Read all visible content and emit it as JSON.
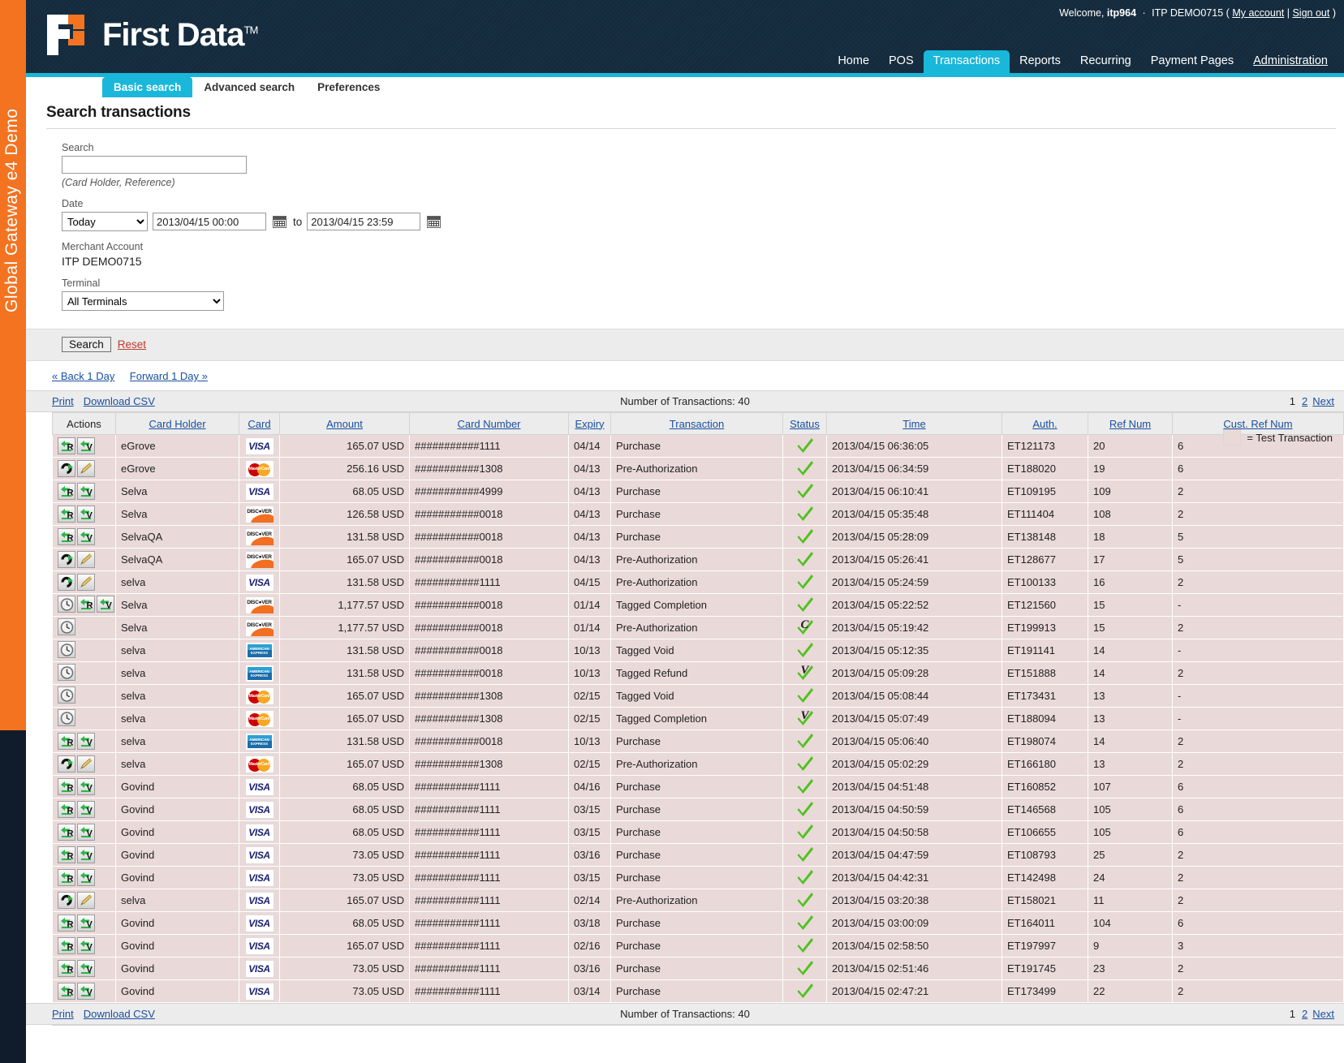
{
  "rail": {
    "label": "Global Gateway e4 Demo"
  },
  "header": {
    "brand_name": "First Data",
    "brand_tm": "TM",
    "welcome_prefix": "Welcome,",
    "user": "itp964",
    "separator": "·",
    "merchant": "ITP DEMO0715",
    "paren_open": "(",
    "my_account": "My account",
    "pipe": "|",
    "sign_out": "Sign out",
    "paren_close": ")",
    "nav": [
      {
        "label": "Home",
        "state": "normal"
      },
      {
        "label": "POS",
        "state": "normal"
      },
      {
        "label": "Transactions",
        "state": "active"
      },
      {
        "label": "Reports",
        "state": "normal"
      },
      {
        "label": "Recurring",
        "state": "normal"
      },
      {
        "label": "Payment Pages",
        "state": "normal"
      },
      {
        "label": "Administration",
        "state": "underline"
      }
    ]
  },
  "subtabs": [
    {
      "label": "Basic search",
      "active": true
    },
    {
      "label": "Advanced search",
      "active": false
    },
    {
      "label": "Preferences",
      "active": false
    }
  ],
  "page": {
    "title": "Search transactions"
  },
  "form": {
    "search_label": "Search",
    "search_value": "",
    "search_placeholder": "",
    "search_hint": "(Card Holder, Reference)",
    "date_label": "Date",
    "date_preset": "Today",
    "date_preset_options": [
      "Today"
    ],
    "date_from": "2013/04/15 00:00",
    "date_to": "2013/04/15 23:59",
    "date_to_word": "to",
    "merchant_label": "Merchant Account",
    "merchant_value": "ITP DEMO0715",
    "terminal_label": "Terminal",
    "terminal_value": "All Terminals",
    "terminal_options": [
      "All Terminals"
    ],
    "search_button": "Search",
    "reset_link": "Reset"
  },
  "daynav": {
    "back": "« Back 1 Day",
    "forward": "Forward 1 Day »"
  },
  "legend": {
    "text": "= Test Transaction",
    "swatch_color": "#ead9d9"
  },
  "toolbar": {
    "print": "Print",
    "download_csv": "Download CSV",
    "count_text": "Number of Transactions: 40",
    "page_current": "1",
    "page_two": "2",
    "next": "Next"
  },
  "table": {
    "columns": [
      {
        "label": "Actions",
        "sortable": false,
        "key": "actions"
      },
      {
        "label": "Card Holder",
        "sortable": true,
        "key": "holder"
      },
      {
        "label": "Card",
        "sortable": true,
        "key": "card"
      },
      {
        "label": "Amount",
        "sortable": true,
        "key": "amount"
      },
      {
        "label": "Card Number",
        "sortable": true,
        "key": "number"
      },
      {
        "label": "Expiry",
        "sortable": true,
        "key": "expiry"
      },
      {
        "label": "Transaction",
        "sortable": true,
        "key": "transaction"
      },
      {
        "label": "Status",
        "sortable": true,
        "key": "status"
      },
      {
        "label": "Time",
        "sortable": true,
        "key": "time"
      },
      {
        "label": "Auth.",
        "sortable": true,
        "key": "auth"
      },
      {
        "label": "Ref Num",
        "sortable": true,
        "key": "refnum"
      },
      {
        "label": "Cust. Ref Num",
        "sortable": true,
        "key": "custref"
      }
    ],
    "rows": [
      {
        "actions": [
          "refund",
          "void"
        ],
        "holder": "eGrove",
        "card": "visa",
        "amount": "165.07  USD",
        "number": "###########1111",
        "expiry": "04/14",
        "transaction": "Purchase",
        "status": "check",
        "time": "2013/04/15 06:36:05",
        "auth": "ET121173",
        "refnum": "20",
        "custref": "6"
      },
      {
        "actions": [
          "complete",
          "edit"
        ],
        "holder": "eGrove",
        "card": "mc",
        "amount": "256.16  USD",
        "number": "###########1308",
        "expiry": "04/13",
        "transaction": "Pre-Authorization",
        "status": "check",
        "time": "2013/04/15 06:34:59",
        "auth": "ET188020",
        "refnum": "19",
        "custref": "6"
      },
      {
        "actions": [
          "refund",
          "void"
        ],
        "holder": "Selva",
        "card": "visa",
        "amount": "68.05  USD",
        "number": "###########4999",
        "expiry": "04/13",
        "transaction": "Purchase",
        "status": "check",
        "time": "2013/04/15 06:10:41",
        "auth": "ET109195",
        "refnum": "109",
        "custref": "2"
      },
      {
        "actions": [
          "refund",
          "void"
        ],
        "holder": "Selva",
        "card": "discover",
        "amount": "126.58  USD",
        "number": "###########0018",
        "expiry": "04/13",
        "transaction": "Purchase",
        "status": "check",
        "time": "2013/04/15 05:35:48",
        "auth": "ET111404",
        "refnum": "108",
        "custref": "2"
      },
      {
        "actions": [
          "refund",
          "void"
        ],
        "holder": "SelvaQA",
        "card": "discover",
        "amount": "131.58  USD",
        "number": "###########0018",
        "expiry": "04/13",
        "transaction": "Purchase",
        "status": "check",
        "time": "2013/04/15 05:28:09",
        "auth": "ET138148",
        "refnum": "18",
        "custref": "5"
      },
      {
        "actions": [
          "complete",
          "edit"
        ],
        "holder": "SelvaQA",
        "card": "discover",
        "amount": "165.07  USD",
        "number": "###########0018",
        "expiry": "04/13",
        "transaction": "Pre-Authorization",
        "status": "check",
        "time": "2013/04/15 05:26:41",
        "auth": "ET128677",
        "refnum": "17",
        "custref": "5"
      },
      {
        "actions": [
          "complete",
          "edit"
        ],
        "holder": "selva",
        "card": "visa",
        "amount": "131.58  USD",
        "number": "###########1111",
        "expiry": "04/15",
        "transaction": "Pre-Authorization",
        "status": "check",
        "time": "2013/04/15 05:24:59",
        "auth": "ET100133",
        "refnum": "16",
        "custref": "2"
      },
      {
        "actions": [
          "history",
          "refund",
          "void"
        ],
        "holder": "Selva",
        "card": "discover",
        "amount": "1,177.57  USD",
        "number": "###########0018",
        "expiry": "01/14",
        "transaction": "Tagged Completion",
        "status": "check",
        "time": "2013/04/15 05:22:52",
        "auth": "ET121560",
        "refnum": "15",
        "custref": "-"
      },
      {
        "actions": [
          "history"
        ],
        "holder": "Selva",
        "card": "discover",
        "amount": "1,177.57  USD",
        "number": "###########0018",
        "expiry": "01/14",
        "transaction": "Pre-Authorization",
        "status": "check-c",
        "time": "2013/04/15 05:19:42",
        "auth": "ET199913",
        "refnum": "15",
        "custref": "2"
      },
      {
        "actions": [
          "history"
        ],
        "holder": "selva",
        "card": "amex",
        "amount": "131.58  USD",
        "number": "###########0018",
        "expiry": "10/13",
        "transaction": "Tagged Void",
        "status": "check",
        "time": "2013/04/15 05:12:35",
        "auth": "ET191141",
        "refnum": "14",
        "custref": "-"
      },
      {
        "actions": [
          "history"
        ],
        "holder": "selva",
        "card": "amex",
        "amount": "131.58  USD",
        "number": "###########0018",
        "expiry": "10/13",
        "transaction": "Tagged Refund",
        "status": "check-v",
        "time": "2013/04/15 05:09:28",
        "auth": "ET151888",
        "refnum": "14",
        "custref": "2"
      },
      {
        "actions": [
          "history"
        ],
        "holder": "selva",
        "card": "mc",
        "amount": "165.07  USD",
        "number": "###########1308",
        "expiry": "02/15",
        "transaction": "Tagged Void",
        "status": "check",
        "time": "2013/04/15 05:08:44",
        "auth": "ET173431",
        "refnum": "13",
        "custref": "-"
      },
      {
        "actions": [
          "history"
        ],
        "holder": "selva",
        "card": "mc",
        "amount": "165.07  USD",
        "number": "###########1308",
        "expiry": "02/15",
        "transaction": "Tagged Completion",
        "status": "check-v",
        "time": "2013/04/15 05:07:49",
        "auth": "ET188094",
        "refnum": "13",
        "custref": "-"
      },
      {
        "actions": [
          "refund",
          "void"
        ],
        "holder": "selva",
        "card": "amex",
        "amount": "131.58  USD",
        "number": "###########0018",
        "expiry": "10/13",
        "transaction": "Purchase",
        "status": "check",
        "time": "2013/04/15 05:06:40",
        "auth": "ET198074",
        "refnum": "14",
        "custref": "2"
      },
      {
        "actions": [
          "complete",
          "edit"
        ],
        "holder": "selva",
        "card": "mc",
        "amount": "165.07  USD",
        "number": "###########1308",
        "expiry": "02/15",
        "transaction": "Pre-Authorization",
        "status": "check",
        "time": "2013/04/15 05:02:29",
        "auth": "ET166180",
        "refnum": "13",
        "custref": "2"
      },
      {
        "actions": [
          "refund",
          "void"
        ],
        "holder": "Govind",
        "card": "visa",
        "amount": "68.05  USD",
        "number": "###########1111",
        "expiry": "04/16",
        "transaction": "Purchase",
        "status": "check",
        "time": "2013/04/15 04:51:48",
        "auth": "ET160852",
        "refnum": "107",
        "custref": "6"
      },
      {
        "actions": [
          "refund",
          "void"
        ],
        "holder": "Govind",
        "card": "visa",
        "amount": "68.05  USD",
        "number": "###########1111",
        "expiry": "03/15",
        "transaction": "Purchase",
        "status": "check",
        "time": "2013/04/15 04:50:59",
        "auth": "ET146568",
        "refnum": "105",
        "custref": "6"
      },
      {
        "actions": [
          "refund",
          "void"
        ],
        "holder": "Govind",
        "card": "visa",
        "amount": "68.05  USD",
        "number": "###########1111",
        "expiry": "03/15",
        "transaction": "Purchase",
        "status": "check",
        "time": "2013/04/15 04:50:58",
        "auth": "ET106655",
        "refnum": "105",
        "custref": "6"
      },
      {
        "actions": [
          "refund",
          "void"
        ],
        "holder": "Govind",
        "card": "visa",
        "amount": "73.05  USD",
        "number": "###########1111",
        "expiry": "03/16",
        "transaction": "Purchase",
        "status": "check",
        "time": "2013/04/15 04:47:59",
        "auth": "ET108793",
        "refnum": "25",
        "custref": "2"
      },
      {
        "actions": [
          "refund",
          "void"
        ],
        "holder": "Govind",
        "card": "visa",
        "amount": "73.05  USD",
        "number": "###########1111",
        "expiry": "03/15",
        "transaction": "Purchase",
        "status": "check",
        "time": "2013/04/15 04:42:31",
        "auth": "ET142498",
        "refnum": "24",
        "custref": "2"
      },
      {
        "actions": [
          "complete",
          "edit"
        ],
        "holder": "selva",
        "card": "visa",
        "amount": "165.07  USD",
        "number": "###########1111",
        "expiry": "02/14",
        "transaction": "Pre-Authorization",
        "status": "check",
        "time": "2013/04/15 03:20:38",
        "auth": "ET158021",
        "refnum": "11",
        "custref": "2"
      },
      {
        "actions": [
          "refund",
          "void"
        ],
        "holder": "Govind",
        "card": "visa",
        "amount": "68.05  USD",
        "number": "###########1111",
        "expiry": "03/18",
        "transaction": "Purchase",
        "status": "check",
        "time": "2013/04/15 03:00:09",
        "auth": "ET164011",
        "refnum": "104",
        "custref": "6"
      },
      {
        "actions": [
          "refund",
          "void"
        ],
        "holder": "Govind",
        "card": "visa",
        "amount": "165.07  USD",
        "number": "###########1111",
        "expiry": "02/16",
        "transaction": "Purchase",
        "status": "check",
        "time": "2013/04/15 02:58:50",
        "auth": "ET197997",
        "refnum": "9",
        "custref": "3"
      },
      {
        "actions": [
          "refund",
          "void"
        ],
        "holder": "Govind",
        "card": "visa",
        "amount": "73.05  USD",
        "number": "###########1111",
        "expiry": "03/16",
        "transaction": "Purchase",
        "status": "check",
        "time": "2013/04/15 02:51:46",
        "auth": "ET191745",
        "refnum": "23",
        "custref": "2"
      },
      {
        "actions": [
          "refund",
          "void"
        ],
        "holder": "Govind",
        "card": "visa",
        "amount": "73.05  USD",
        "number": "###########1111",
        "expiry": "03/14",
        "transaction": "Purchase",
        "status": "check",
        "time": "2013/04/15 02:47:21",
        "auth": "ET173499",
        "refnum": "22",
        "custref": "2"
      }
    ]
  },
  "icons": {
    "refund": "refund-icon",
    "void": "void-icon",
    "complete": "complete-icon",
    "edit": "edit-icon",
    "history": "history-icon",
    "check": "status-approved-icon",
    "check-c": "status-completed-icon",
    "check-v": "status-voided-icon"
  },
  "colors": {
    "accent_teal": "#19b7d9",
    "brand_orange": "#f37321",
    "header_navy": "#142b3d",
    "row_pink": "#ead9d9",
    "link_blue": "#1a4fa0",
    "reset_red": "#c0392b"
  }
}
